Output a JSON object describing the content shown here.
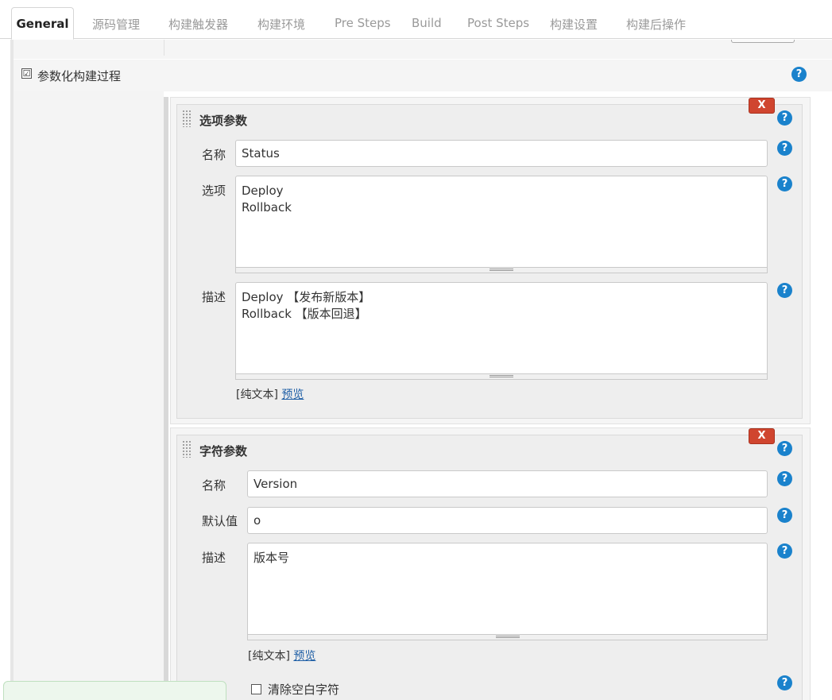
{
  "tabs": [
    {
      "label": "General",
      "active": true
    },
    {
      "label": "源码管理"
    },
    {
      "label": "构建触发器"
    },
    {
      "label": "构建环境"
    },
    {
      "label": "Pre Steps"
    },
    {
      "label": "Build"
    },
    {
      "label": "Post Steps"
    },
    {
      "label": "构建设置"
    },
    {
      "label": "构建后操作"
    }
  ],
  "param_build": {
    "checked": true,
    "check_glyph": "☑",
    "label": "参数化构建过程"
  },
  "help_glyph": "?",
  "choice_param": {
    "title": "选项参数",
    "delete_label": "X",
    "name_label": "名称",
    "name_value": "Status",
    "choices_label": "选项",
    "choices_value": "Deploy\nRollback",
    "desc_label": "描述",
    "desc_value": "Deploy 【发布新版本】\nRollback 【版本回退】",
    "fmt_plain": "[纯文本]",
    "fmt_preview": "预览"
  },
  "string_param": {
    "title": "字符参数",
    "delete_label": "X",
    "name_label": "名称",
    "name_value": "Version",
    "default_label": "默认值",
    "default_value": "o",
    "desc_label": "描述",
    "desc_value": "版本号",
    "fmt_plain": "[纯文本]",
    "fmt_preview": "预览",
    "trim_label": "清除空白字符",
    "trim_checked": false
  },
  "icons": {
    "help": "question-circle-icon",
    "delete": "close-x-icon",
    "drag": "drag-handle-icon",
    "checkbox": "checkbox-icon"
  },
  "colors": {
    "help_icon": "#1a82cc",
    "delete_button": "#d0452f",
    "link": "#1f5fa6",
    "active_tab_text": "#222222",
    "inactive_tab_text": "#9a9a9a"
  }
}
